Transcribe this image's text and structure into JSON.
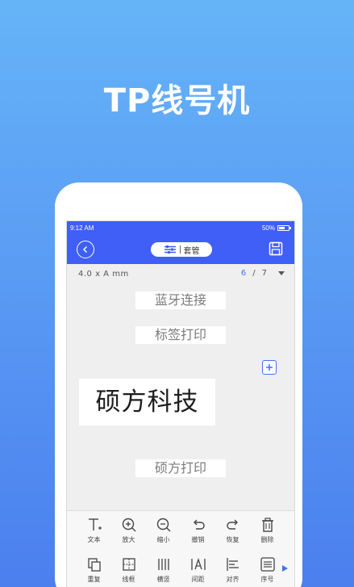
{
  "headline": "TP线号机",
  "status": {
    "time": "9:12 AM",
    "battery": "50%"
  },
  "appbar": {
    "mode_label": "套管"
  },
  "sizebar": {
    "size": "4.0 x A mm",
    "page_current": "6",
    "page_sep": "/",
    "page_total": "7"
  },
  "labels": [
    {
      "text": "蓝牙连接"
    },
    {
      "text": "标签打印"
    },
    {
      "text": "硕方科技"
    },
    {
      "text": "硕方打印"
    }
  ],
  "toolbar": {
    "row1": [
      "文本",
      "放大",
      "缩小",
      "撤销",
      "恢复",
      "删除"
    ],
    "row2": [
      "重复",
      "线框",
      "横竖",
      "间距",
      "对齐",
      "序号"
    ]
  },
  "colors": {
    "accent": "#3f5ff6",
    "link": "#3f73f0",
    "background_top": "#66b4f8",
    "background_bottom": "#4b7fee"
  }
}
